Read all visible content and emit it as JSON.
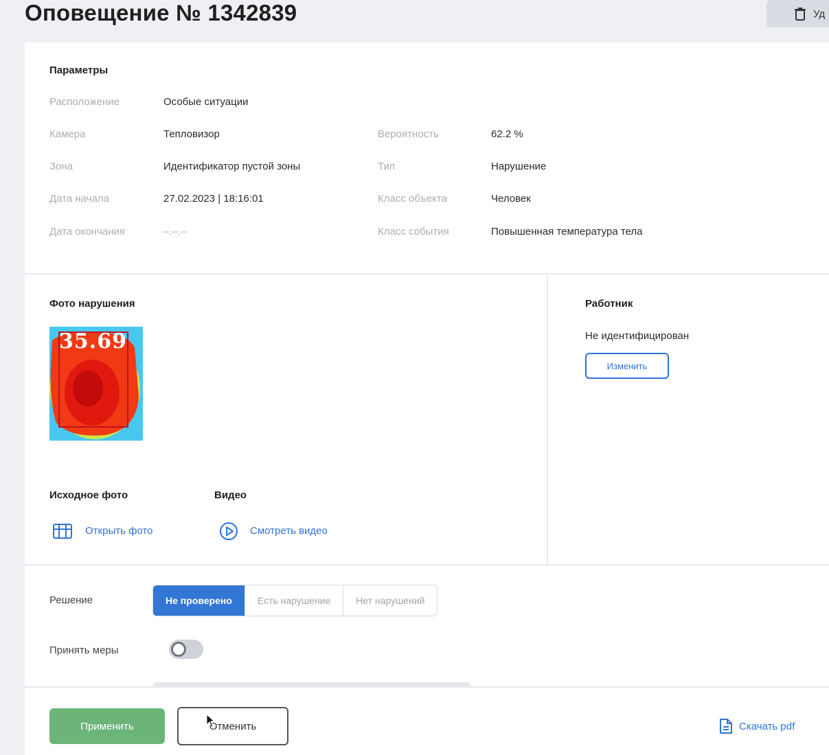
{
  "header": {
    "title": "Оповещение № 1342839",
    "action_label": "Уд"
  },
  "params": {
    "section_title": "Параметры",
    "location": {
      "label": "Расположение",
      "value": "Особые ситуации"
    },
    "camera": {
      "label": "Камера",
      "value": "Тепловизор"
    },
    "zone": {
      "label": "Зона",
      "value": "Идентификатор пустой зоны"
    },
    "start_date": {
      "label": "Дата начала",
      "value": "27.02.2023 | 18:16:01"
    },
    "end_date": {
      "label": "Дата окончания",
      "value": "–.–.–"
    },
    "probability": {
      "label": "Вероятность",
      "value": "62.2 %"
    },
    "type": {
      "label": "Тип",
      "value": "Нарушение"
    },
    "object_class": {
      "label": "Класс объекта",
      "value": "Человек"
    },
    "event_class": {
      "label": "Класс события",
      "value": "Повышенная температура тела"
    }
  },
  "violation": {
    "section_title": "Фото нарушения",
    "photo_temperature": "35.69",
    "source_photo_title": "Исходное фото",
    "open_photo_label": "Открыть фото",
    "video_title": "Видео",
    "watch_video_label": "Смотреть видео"
  },
  "worker": {
    "section_title": "Работник",
    "status": "Не идентифицирован",
    "change_label": "Изменить"
  },
  "decision": {
    "label": "Решение",
    "options": [
      "Не проверено",
      "Есть нарушение",
      "Нет нарушений"
    ],
    "selected": "Не проверено"
  },
  "measures": {
    "label": "Принять меры",
    "enabled": false
  },
  "footer": {
    "apply_label": "Применить",
    "cancel_label": "Отменить",
    "download_label": "Скачать pdf"
  },
  "colors": {
    "accent": "#3276d6",
    "apply": "#6cb579",
    "label_gray": "#a9adb4"
  }
}
